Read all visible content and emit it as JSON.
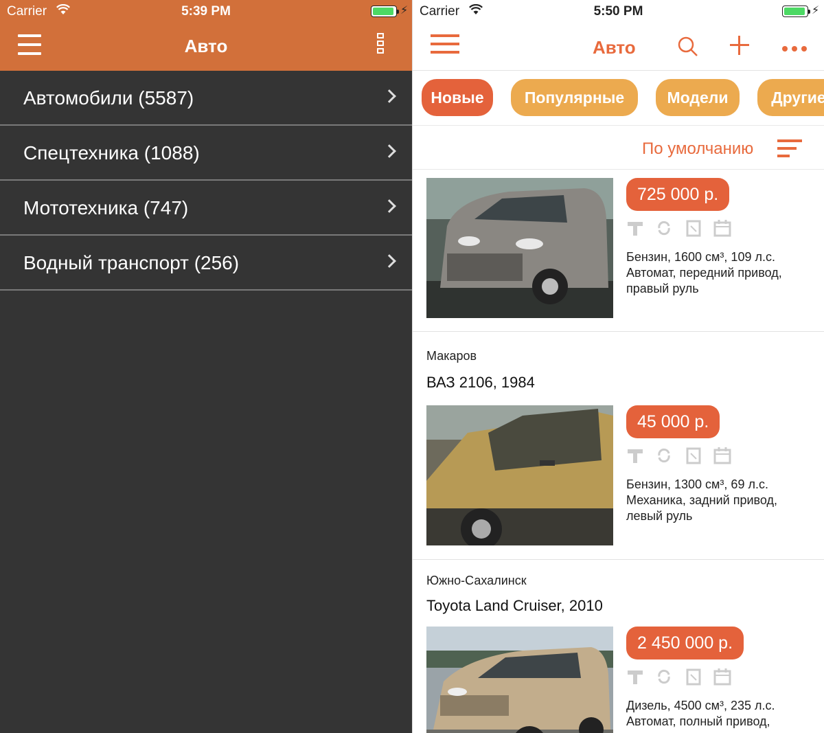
{
  "left_screen": {
    "status": {
      "carrier": "Carrier",
      "time": "5:39 PM"
    },
    "header": {
      "title": "Авто"
    },
    "categories": [
      {
        "label": "Автомобили (5587)"
      },
      {
        "label": "Спецтехника (1088)"
      },
      {
        "label": "Мототехника (747)"
      },
      {
        "label": "Водный транспорт (256)"
      }
    ],
    "colors": {
      "header_bg": "#d2703a",
      "body_bg": "#343434"
    }
  },
  "right_screen": {
    "status": {
      "carrier": "Carrier",
      "time": "5:50 PM"
    },
    "header": {
      "title": "Авто"
    },
    "filters": [
      {
        "label": "Новые",
        "active": true
      },
      {
        "label": "Популярные",
        "active": false
      },
      {
        "label": "Модели",
        "active": false
      },
      {
        "label": "Другие",
        "active": false
      }
    ],
    "sort": {
      "label": "По умолчанию"
    },
    "listings": [
      {
        "city": "",
        "title": "",
        "price": "725 000 р.",
        "specs": [
          "Бензин, 1600 см³, 109 л.с.",
          "Автомат, передний привод,",
          "правый руль"
        ],
        "photo": "gray-minivan-photo"
      },
      {
        "city": "Макаров",
        "title": "ВАЗ 2106, 1984",
        "price": "45 000 р.",
        "specs": [
          "Бензин, 1300 см³, 69 л.с.",
          "Механика, задний привод,",
          "левый руль"
        ],
        "photo": "gold-sedan-photo"
      },
      {
        "city": "Южно-Сахалинск",
        "title": "Toyota Land Cruiser, 2010",
        "price": "2 450 000 р.",
        "specs": [
          "Дизель, 4500 см³, 235 л.с.",
          "Автомат, полный привод,"
        ],
        "photo": "beige-suv-photo"
      }
    ],
    "colors": {
      "accent": "#e86a3d",
      "chip_active": "#e4623b",
      "chip_inactive": "#ecaa4f"
    }
  }
}
